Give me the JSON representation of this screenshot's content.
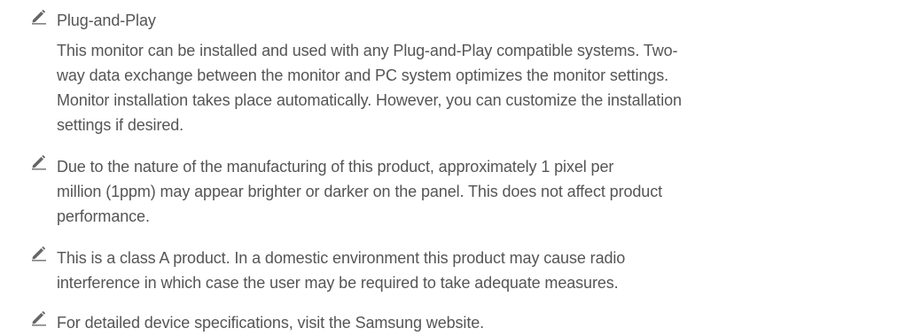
{
  "notes": [
    {
      "icon": "pencil-icon",
      "heading": "Plug-and-Play",
      "lines": [
        "This monitor can be installed and used with any Plug-and-Play compatible systems. Two-",
        "way data exchange between the monitor and PC system optimizes the monitor settings.",
        "Monitor installation takes place automatically. However, you can customize the installation",
        "settings if desired."
      ]
    },
    {
      "icon": "pencil-icon",
      "lines": [
        "Due to the nature of the manufacturing of this product, approximately 1 pixel per",
        "million (1ppm) may appear brighter or darker on the panel. This does not affect product",
        "performance."
      ]
    },
    {
      "icon": "pencil-icon",
      "lines": [
        "This is a class A product. In a domestic environment this product may cause radio",
        "interference in which case the user may be required to take adequate measures."
      ]
    },
    {
      "icon": "pencil-icon",
      "lines": [
        "For detailed device specifications, visit the Samsung website."
      ]
    }
  ],
  "colors": {
    "text": "#555555",
    "icon": "#666666"
  }
}
